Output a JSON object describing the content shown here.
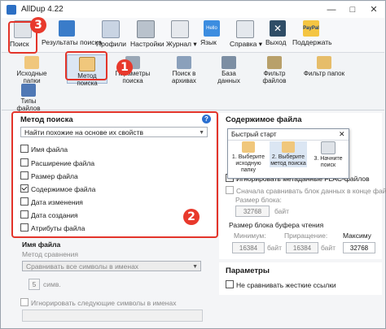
{
  "window": {
    "title": "AllDup 4.22"
  },
  "toolbar1": {
    "items": [
      {
        "label": "Поиск"
      },
      {
        "label": "Результаты поиска"
      },
      {
        "label": "Профили"
      },
      {
        "label": "Настройки"
      },
      {
        "label": "Журнал"
      },
      {
        "label": "Язык"
      },
      {
        "label": "Справка"
      },
      {
        "label": "Выход"
      },
      {
        "label": "Поддержать"
      }
    ],
    "lang_badge": "Hello",
    "paypal_badge": "PayPal",
    "dropdown_glyph": "▾"
  },
  "toolbar2": {
    "items": [
      {
        "label": "Исходные папки"
      },
      {
        "label": "Метод поиска"
      },
      {
        "label": "Параметры поиска"
      },
      {
        "label": "Поиск в архивах"
      },
      {
        "label": "База данных"
      },
      {
        "label": "Фильтр файлов"
      },
      {
        "label": "Фильтр папок"
      },
      {
        "label": "Типы файлов"
      }
    ]
  },
  "callouts": [
    "1",
    "2",
    "3"
  ],
  "search_method": {
    "title": "Метод поиска",
    "info_glyph": "?",
    "mode": "Найти похожие на основе их свойств",
    "options": [
      {
        "label": "Имя файла",
        "checked": false
      },
      {
        "label": "Расширение файла",
        "checked": false
      },
      {
        "label": "Размер файла",
        "checked": false
      },
      {
        "label": "Содержимое файла",
        "checked": true
      },
      {
        "label": "Дата изменения",
        "checked": false
      },
      {
        "label": "Дата создания",
        "checked": false
      },
      {
        "label": "Атрибуты файла",
        "checked": false
      }
    ]
  },
  "file_name": {
    "title": "Имя файла",
    "compare_label": "Метод сравнения",
    "compare_value": "Сравнивать все символы в именах",
    "chars_value": "5",
    "chars_unit": "симв.",
    "ignore_label": "Игнорировать следующие символы в именах"
  },
  "file_content": {
    "title": "Содержимое файла",
    "ignore_flac": "Игнорировать метаданные FLAC-файлов",
    "compare_end": "Сначала сравнивать блок данных в конце файл",
    "block_size_label": "Размер блока:",
    "block_size_value": "32768",
    "unit": "байт",
    "buffer_label": "Размер блока буфера чтения",
    "buffer_min_label": "Минимум:",
    "buffer_inc_label": "Приращение:",
    "buffer_max_label": "Максиму",
    "buffer_min": "16384",
    "buffer_inc": "16384",
    "buffer_max": "32768"
  },
  "quick_start": {
    "title": "Быстрый старт",
    "close_glyph": "✕",
    "steps": [
      {
        "label": "1. Выберите исходную папку"
      },
      {
        "label": "2. Выберите метод поиска"
      },
      {
        "label": "3. Начните поиск"
      }
    ]
  },
  "params": {
    "title": "Параметры",
    "no_strict_links": "Не сравнивать жесткие ссылки"
  }
}
